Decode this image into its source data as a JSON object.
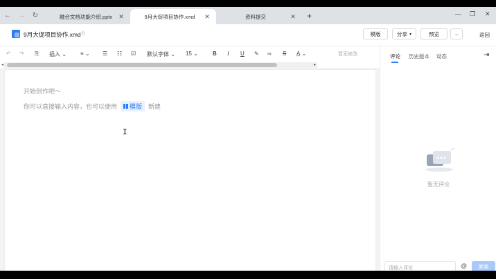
{
  "browser": {
    "tabs": [
      {
        "label": "融合文档功能介绍.pptx",
        "active": false
      },
      {
        "label": "9月大促项目协作.xmd",
        "active": true
      },
      {
        "label": "资料提交",
        "active": false
      }
    ],
    "new_tab": "+"
  },
  "doc": {
    "title": "9月大促项目协作.xmd",
    "buttons": {
      "template": "模版",
      "share": "分享",
      "preview": "预览",
      "more": "···",
      "back": "返回"
    }
  },
  "toolbar": {
    "insert": "插入",
    "font_family": "默认字体",
    "font_size": "15",
    "bold": "B",
    "italic": "I",
    "underline": "U",
    "strike": "S",
    "status": "暂无修改"
  },
  "editor": {
    "placeholder_line1": "开始创作吧～",
    "placeholder_line2_prefix": "你可以直接输入内容，也可以使用",
    "template_chip": "模版",
    "placeholder_line2_suffix": "新建"
  },
  "panel": {
    "tabs": [
      "评论",
      "历史版本",
      "动态"
    ],
    "empty_text": "暂无评论",
    "comment_placeholder": "请输入评论",
    "at_symbol": "@",
    "send_label": "发表"
  }
}
